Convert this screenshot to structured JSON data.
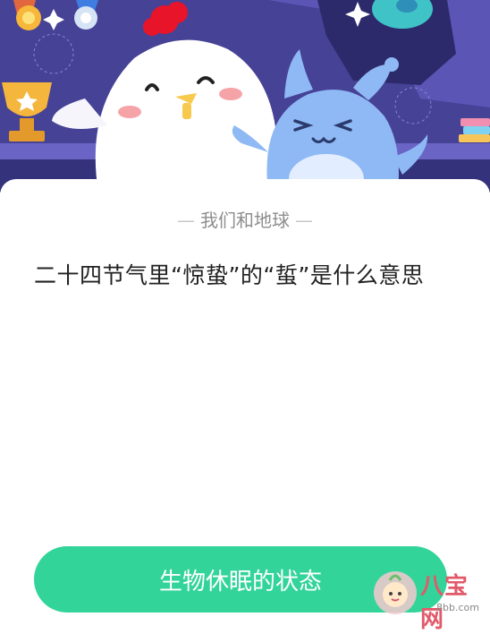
{
  "header": {
    "category": "我们和地球"
  },
  "question": {
    "text": "二十四节气里“惊蛰”的“蜇”是什么意思"
  },
  "answer_button": {
    "label": "生物休眠的状态"
  },
  "watermark": {
    "text": "八宝网",
    "url": "8bb.com"
  },
  "colors": {
    "banner_bg": "#3d3a83",
    "accent_green": "#32d49a",
    "chick_white": "#ffffff",
    "character_blue": "#8fb9f5"
  }
}
